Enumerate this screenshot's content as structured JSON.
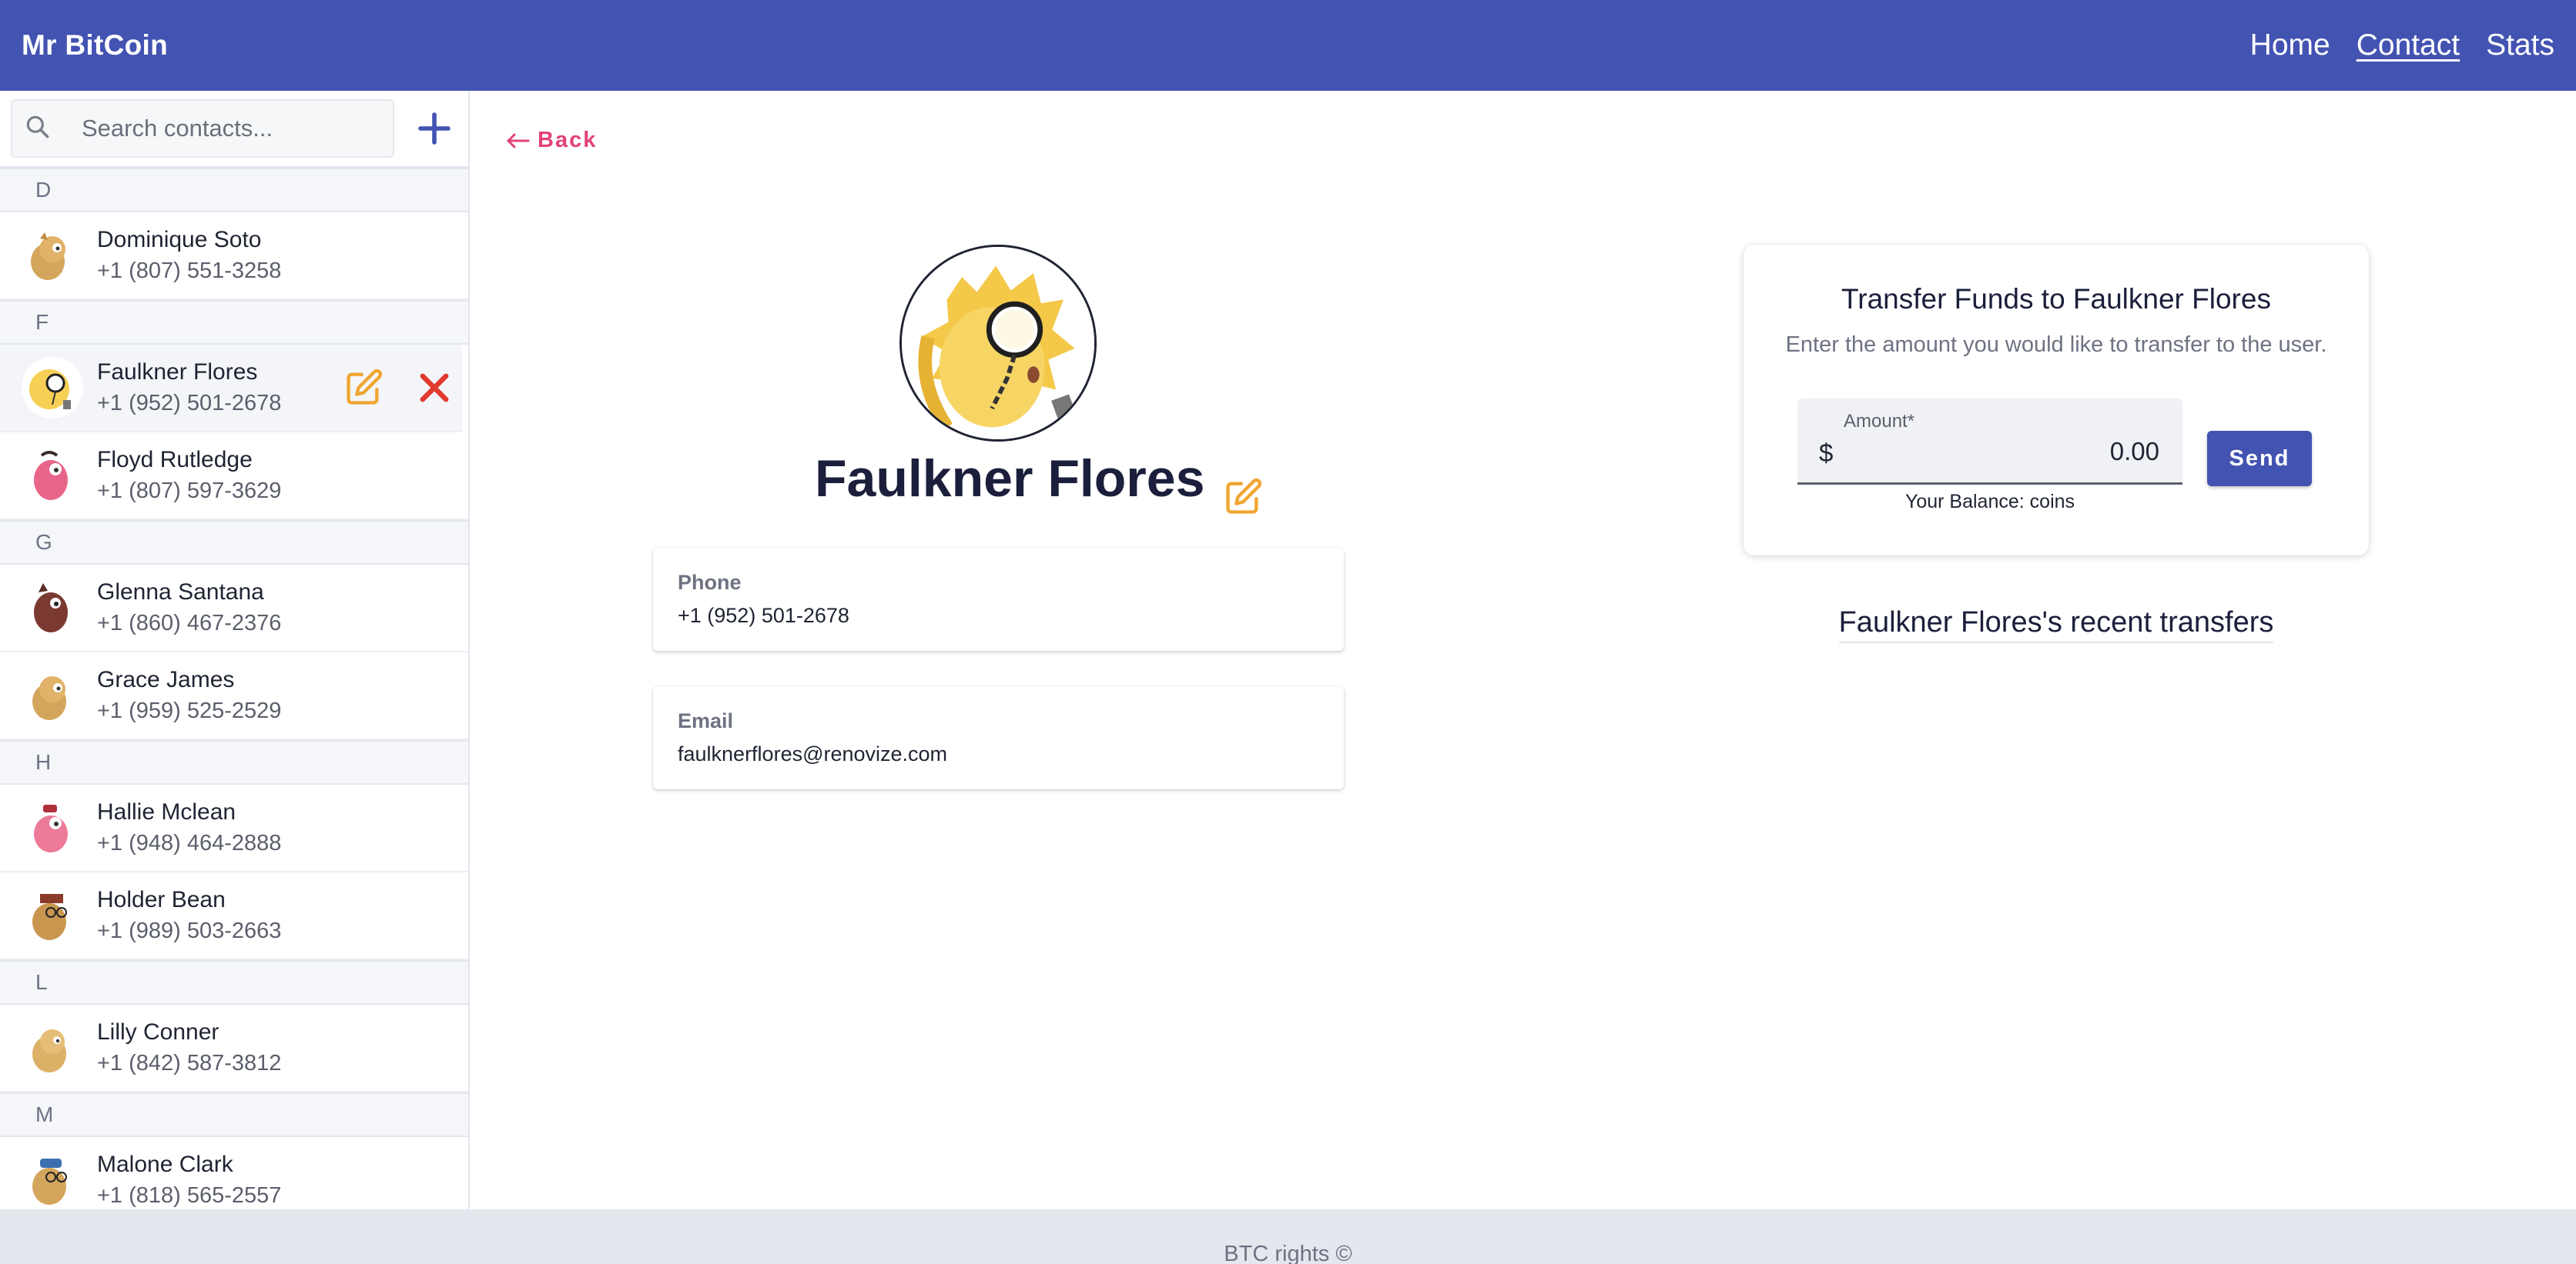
{
  "app": {
    "title": "Mr BitCoin"
  },
  "nav": {
    "home": "Home",
    "contact": "Contact",
    "stats": "Stats"
  },
  "sidebar": {
    "search_placeholder": "Search contacts...",
    "groups": [
      {
        "letter": "D",
        "contacts": [
          {
            "name": "Dominique Soto",
            "phone": "+1 (807) 551-3258"
          }
        ]
      },
      {
        "letter": "F",
        "contacts": [
          {
            "name": "Faulkner Flores",
            "phone": "+1 (952) 501-2678"
          },
          {
            "name": "Floyd Rutledge",
            "phone": "+1 (807) 597-3629"
          }
        ]
      },
      {
        "letter": "G",
        "contacts": [
          {
            "name": "Glenna Santana",
            "phone": "+1 (860) 467-2376"
          },
          {
            "name": "Grace James",
            "phone": "+1 (959) 525-2529"
          }
        ]
      },
      {
        "letter": "H",
        "contacts": [
          {
            "name": "Hallie Mclean",
            "phone": "+1 (948) 464-2888"
          },
          {
            "name": "Holder Bean",
            "phone": "+1 (989) 503-2663"
          }
        ]
      },
      {
        "letter": "L",
        "contacts": [
          {
            "name": "Lilly Conner",
            "phone": "+1 (842) 587-3812"
          }
        ]
      },
      {
        "letter": "M",
        "contacts": [
          {
            "name": "Malone Clark",
            "phone": "+1 (818) 565-2557"
          }
        ]
      }
    ]
  },
  "detail": {
    "back_label": "Back",
    "name": "Faulkner Flores",
    "phone_label": "Phone",
    "phone": "+1 (952) 501-2678",
    "email_label": "Email",
    "email": "faulknerflores@renovize.com"
  },
  "transfer": {
    "title": "Transfer Funds to Faulkner Flores",
    "subtitle": "Enter the amount you would like to transfer to the user.",
    "amount_label": "Amount*",
    "currency": "$",
    "amount_value": "0.00",
    "balance": "Your Balance: coins",
    "send_label": "Send",
    "recent_title": "Faulkner Flores's recent transfers"
  },
  "footer": {
    "text": "BTC rights ©"
  },
  "colors": {
    "primary": "#4353b2",
    "accent_pink": "#e2417a",
    "edit_orange": "#f0a530",
    "delete_red": "#e03a2f"
  }
}
